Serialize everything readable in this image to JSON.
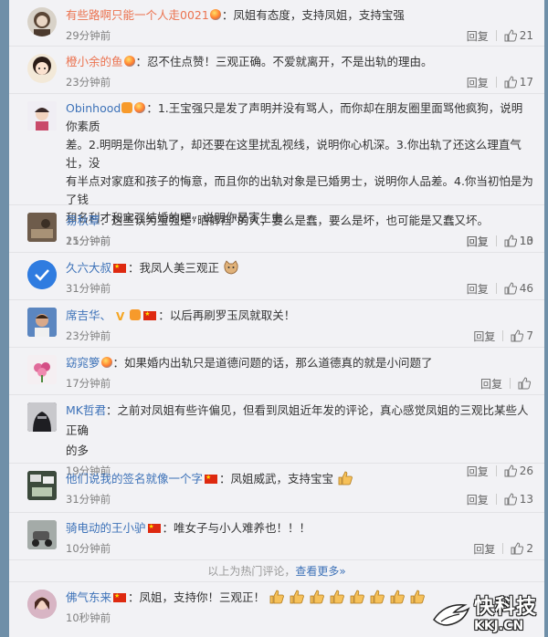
{
  "comments": [
    {
      "user": "有些路啊只能一个人走0021",
      "text": "：凤姐有态度，支持凤姐，支持宝强",
      "time": "29分钟前",
      "reply": "回复",
      "likes": "21"
    },
    {
      "user": "橙小余的鱼",
      "text": "：忍不住点赞！三观正确。不爱就离开，不是出轨的理由。",
      "time": "23分钟前",
      "reply": "回复",
      "likes": "17"
    },
    {
      "user": "Obinhood",
      "text1": "：1.王宝强只是发了声明并没有骂人，而你却在朋友圈里面骂他疯狗，说明你素质",
      "text2": "差。2.明明是你出轨了，却还要在这里扰乱视线，说明你心机深。3.你出轨了还这么理直气壮，没",
      "text3": "有半点对家庭和孩子的悔意，而且你的出轨对象是已婚男士，说明你人品差。4.你当初怕是为了钱",
      "text4": "和名利才和宝强结婚的吧，说明你是寄生虫",
      "time": "15分钟前",
      "reply": "回复",
      "likes": "13"
    },
    {
      "user": "易秋覃",
      "text": "：这些认为宝强是“晒裤裆”的人，要么是蠢，要么是坏，也可能是又蠢又坏。",
      "time": "21分钟前",
      "reply": "回复",
      "likes": "10"
    },
    {
      "user": "久六大叔",
      "text": "：我凤人美三观正",
      "time": "31分钟前",
      "reply": "回复",
      "likes": "46"
    },
    {
      "user": "席吉华、",
      "text": "：以后再刷罗玉凤就取关！",
      "time": "23分钟前",
      "reply": "回复",
      "likes": "7"
    },
    {
      "user": "窈窕箩",
      "text": "：如果婚内出轨只是道德问题的话，那么道德真的就是小问题了",
      "time": "17分钟前",
      "reply": "回复",
      "likes": ""
    },
    {
      "user": "MK哲君",
      "text1": "：之前对凤姐有些许偏见，但看到凤姐近年发的评论，真心感觉凤姐的三观比某些人正确",
      "text2": "的多",
      "time": "19分钟前",
      "reply": "回复",
      "likes": "26"
    },
    {
      "user": "他们说我的签名就像一个字",
      "text": "：凤姐威武，支持宝宝",
      "time": "31分钟前",
      "reply": "回复",
      "likes": "13"
    },
    {
      "user": "骑电动的王小驴",
      "text": "：唯女子与小人难养也！！！",
      "time": "10分钟前",
      "reply": "回复",
      "likes": "2"
    },
    {
      "user": "佛气东来",
      "text": "：凤姐，支持你！三观正！",
      "time": "10秒钟前",
      "reply": "回复",
      "likes": ""
    }
  ],
  "footer": {
    "above": "以上为热门评论，",
    "more": "查看更多»"
  },
  "watermark": {
    "brand": "快科技",
    "url": "KKJ.CN"
  },
  "colors": {
    "username": "#eb7350",
    "link": "#3d72b8",
    "flag": "#de2910"
  }
}
